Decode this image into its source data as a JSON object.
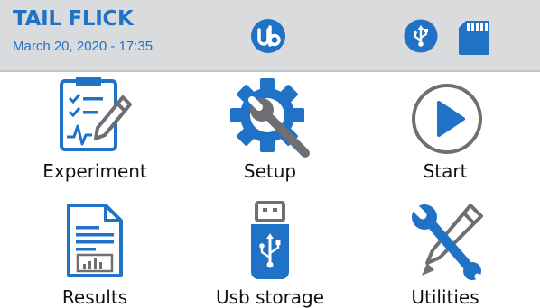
{
  "header": {
    "title": "TAIL FLICK",
    "datetime": "March 20, 2020 - 17:35",
    "icons": [
      "ub-logo-icon",
      "usb-icon",
      "sd-card-icon"
    ]
  },
  "menu": {
    "items": [
      {
        "label": "Experiment",
        "icon": "clipboard-pencil-icon"
      },
      {
        "label": "Setup",
        "icon": "gear-wrench-icon"
      },
      {
        "label": "Start",
        "icon": "play-circle-icon"
      },
      {
        "label": "Results",
        "icon": "report-document-icon"
      },
      {
        "label": "Usb storage",
        "icon": "usb-drive-icon"
      },
      {
        "label": "Utilities",
        "icon": "wrench-pencil-icon"
      }
    ]
  },
  "colors": {
    "accent": "#1f72c6",
    "icon_gray": "#6d6f72",
    "header_bg": "#d9dbdd",
    "text": "#111111"
  }
}
